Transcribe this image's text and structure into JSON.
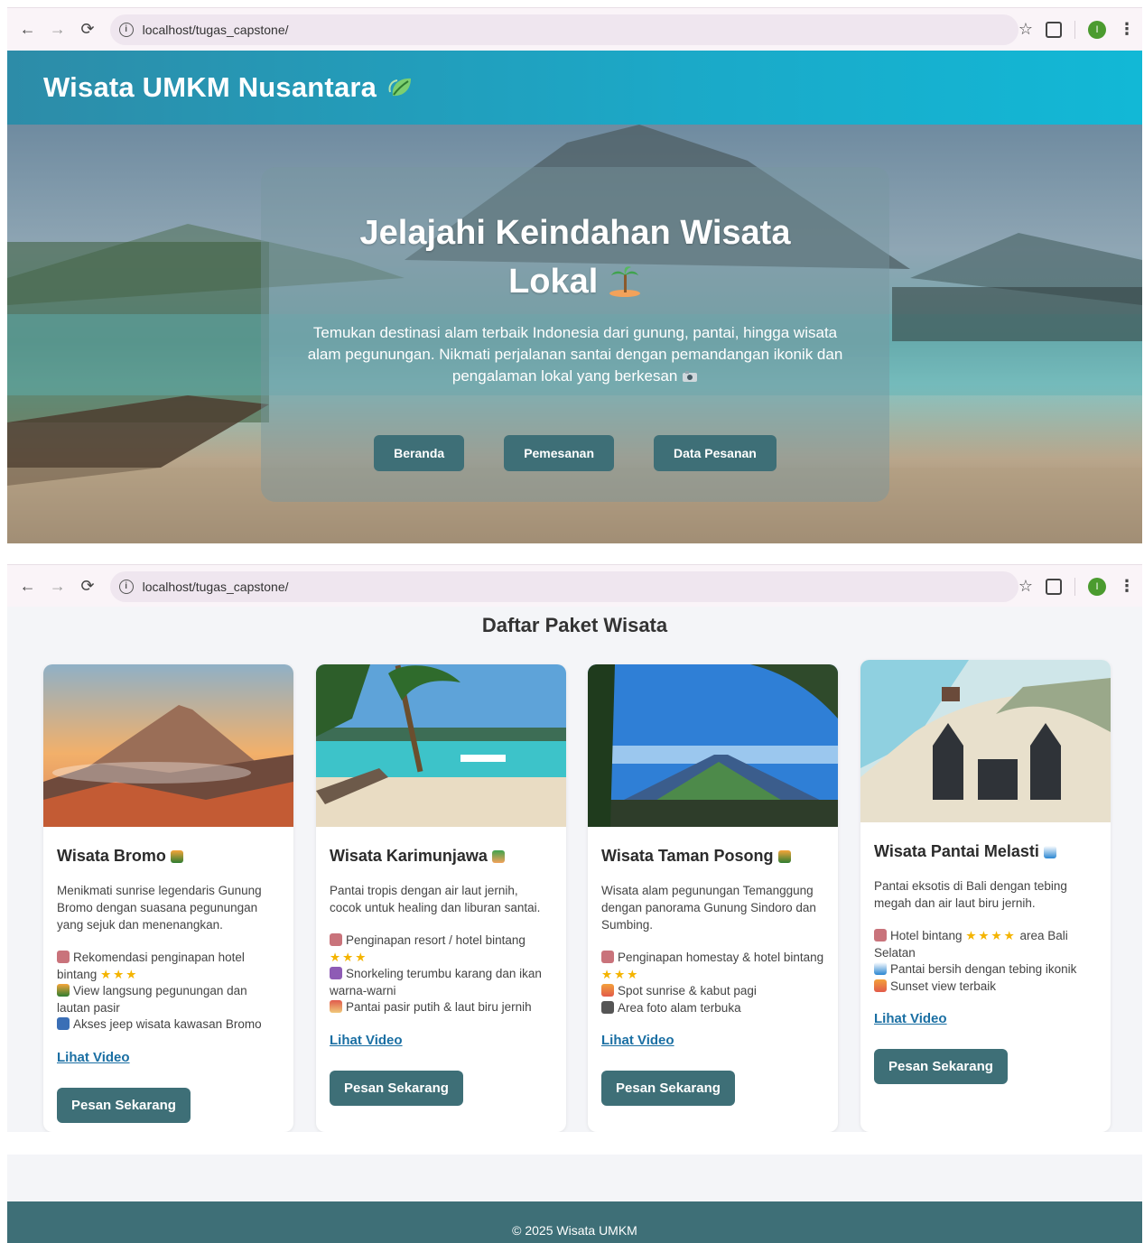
{
  "browser": {
    "url": "localhost/tugas_capstone/",
    "profile_initial": "I",
    "icons": [
      "back-arrow-icon",
      "forward-arrow-icon",
      "reload-icon",
      "site-info-icon",
      "bookmark-star-icon",
      "extensions-icon",
      "profile-avatar",
      "more-menu-icon"
    ]
  },
  "header": {
    "title": "Wisata UMKM Nusantara",
    "icon": "leaf-icon"
  },
  "hero": {
    "title": "Jelajahi Keindahan Wisata Lokal",
    "title_icon": "palm-island-icon",
    "description": "Temukan destinasi alam terbaik Indonesia dari gunung, pantai, hingga wisata alam pegunungan. Nikmati perjalanan santai dengan pemandangan ikonik dan pengalaman lokal yang berkesan",
    "description_icon": "camera-icon",
    "buttons": [
      "Beranda",
      "Pemesanan",
      "Data Pesanan"
    ]
  },
  "packages": {
    "heading": "Daftar Paket Wisata",
    "cards": [
      {
        "title": "Wisata Bromo",
        "desc": "Menikmati sunrise legendaris Gunung Bromo dengan suasana pegunungan yang sejuk dan menenangkan.",
        "features": [
          {
            "icon": "hotel-icon",
            "text": "Rekomendasi penginapan hotel bintang",
            "stars": "★★★"
          },
          {
            "icon": "sunrise-icon",
            "text": "View langsung pegunungan dan lautan pasir",
            "stars": ""
          },
          {
            "icon": "jeep-icon",
            "text": "Akses jeep wisata kawasan Bromo",
            "stars": ""
          }
        ],
        "link": "Lihat Video",
        "button": "Pesan Sekarang"
      },
      {
        "title": "Wisata Karimunjawa",
        "desc": "Pantai tropis dengan air laut jernih, cocok untuk healing dan liburan santai.",
        "features": [
          {
            "icon": "hotel-icon",
            "text": "Penginapan resort / hotel bintang",
            "stars": "★★★"
          },
          {
            "icon": "snorkel-icon",
            "text": "Snorkeling terumbu karang dan ikan warna-warni",
            "stars": ""
          },
          {
            "icon": "beach-icon",
            "text": "Pantai pasir putih & laut biru jernih",
            "stars": ""
          }
        ],
        "link": "Lihat Video",
        "button": "Pesan Sekarang"
      },
      {
        "title": "Wisata Taman Posong",
        "desc": "Wisata alam pegunungan Temanggung dengan panorama Gunung Sindoro dan Sumbing.",
        "features": [
          {
            "icon": "hotel-icon",
            "text": "Penginapan homestay & hotel bintang",
            "stars": "★★★"
          },
          {
            "icon": "sunrise-icon",
            "text": "Spot sunrise & kabut pagi",
            "stars": ""
          },
          {
            "icon": "camera-icon",
            "text": "Area foto alam terbuka",
            "stars": ""
          }
        ],
        "link": "Lihat Video",
        "button": "Pesan Sekarang"
      },
      {
        "title": "Wisata Pantai Melasti",
        "desc": "Pantai eksotis di Bali dengan tebing megah dan air laut biru jernih.",
        "features": [
          {
            "icon": "hotel-icon",
            "text": "Hotel bintang",
            "stars": "★★★★",
            "suffix": "area Bali Selatan"
          },
          {
            "icon": "wave-icon",
            "text": "Pantai bersih dengan tebing ikonik",
            "stars": ""
          },
          {
            "icon": "sunset-icon",
            "text": "Sunset view terbaik",
            "stars": ""
          }
        ],
        "link": "Lihat Video",
        "button": "Pesan Sekarang"
      }
    ]
  },
  "footer": {
    "text": "© 2025 Wisata UMKM"
  },
  "colors": {
    "header": "#1ba9c8",
    "button": "#3e6f77",
    "link": "#1a6fa3",
    "star": "#f4b400"
  }
}
